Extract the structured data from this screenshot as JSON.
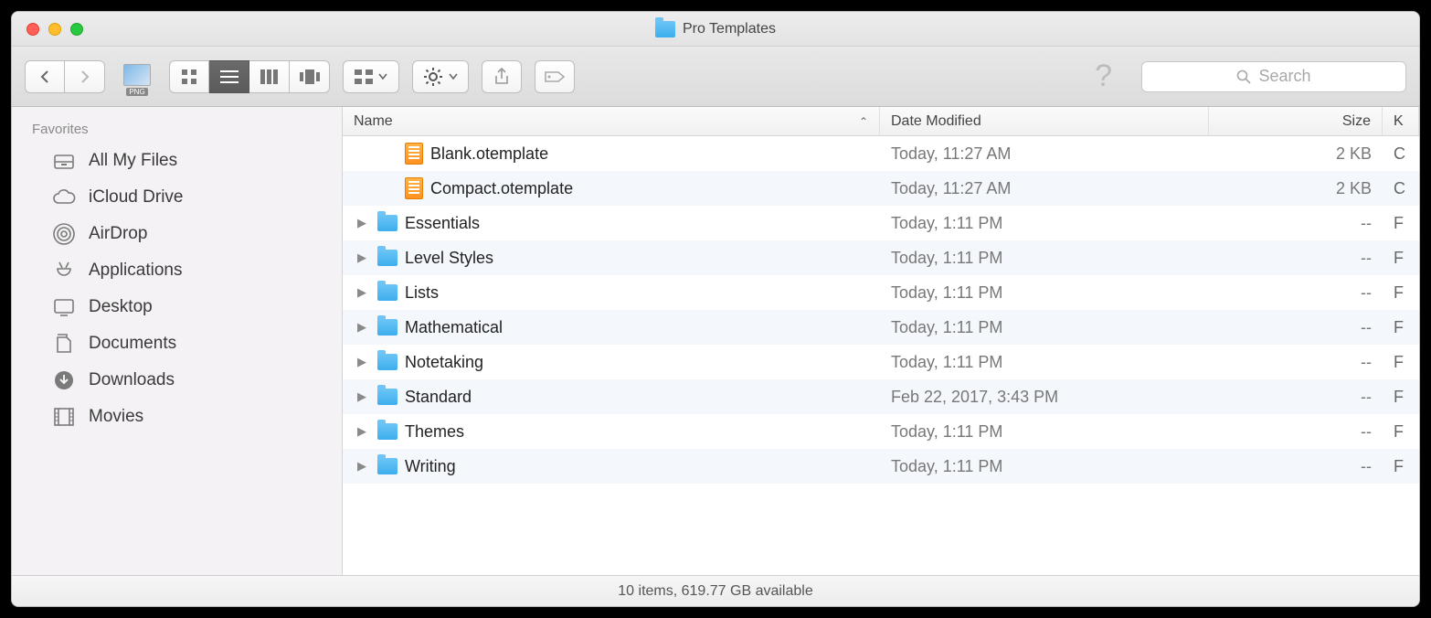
{
  "window": {
    "title": "Pro Templates"
  },
  "toolbar": {
    "png_label": "PNG",
    "search_placeholder": "Search"
  },
  "sidebar": {
    "header": "Favorites",
    "items": [
      {
        "label": "All My Files",
        "icon": "all-my-files"
      },
      {
        "label": "iCloud Drive",
        "icon": "icloud"
      },
      {
        "label": "AirDrop",
        "icon": "airdrop"
      },
      {
        "label": "Applications",
        "icon": "applications"
      },
      {
        "label": "Desktop",
        "icon": "desktop"
      },
      {
        "label": "Documents",
        "icon": "documents"
      },
      {
        "label": "Downloads",
        "icon": "downloads"
      },
      {
        "label": "Movies",
        "icon": "movies"
      }
    ]
  },
  "columns": {
    "name": "Name",
    "date": "Date Modified",
    "size": "Size",
    "kind_initial": "K"
  },
  "files": [
    {
      "type": "file",
      "name": "Blank.otemplate",
      "date": "Today, 11:27 AM",
      "size": "2 KB",
      "kind_initial": "C"
    },
    {
      "type": "file",
      "name": "Compact.otemplate",
      "date": "Today, 11:27 AM",
      "size": "2 KB",
      "kind_initial": "C"
    },
    {
      "type": "folder",
      "name": "Essentials",
      "date": "Today, 1:11 PM",
      "size": "--",
      "kind_initial": "F"
    },
    {
      "type": "folder",
      "name": "Level Styles",
      "date": "Today, 1:11 PM",
      "size": "--",
      "kind_initial": "F"
    },
    {
      "type": "folder",
      "name": "Lists",
      "date": "Today, 1:11 PM",
      "size": "--",
      "kind_initial": "F"
    },
    {
      "type": "folder",
      "name": "Mathematical",
      "date": "Today, 1:11 PM",
      "size": "--",
      "kind_initial": "F"
    },
    {
      "type": "folder",
      "name": "Notetaking",
      "date": "Today, 1:11 PM",
      "size": "--",
      "kind_initial": "F"
    },
    {
      "type": "folder",
      "name": "Standard",
      "date": "Feb 22, 2017, 3:43 PM",
      "size": "--",
      "kind_initial": "F"
    },
    {
      "type": "folder",
      "name": "Themes",
      "date": "Today, 1:11 PM",
      "size": "--",
      "kind_initial": "F"
    },
    {
      "type": "folder",
      "name": "Writing",
      "date": "Today, 1:11 PM",
      "size": "--",
      "kind_initial": "F"
    }
  ],
  "status": "10 items, 619.77 GB available"
}
